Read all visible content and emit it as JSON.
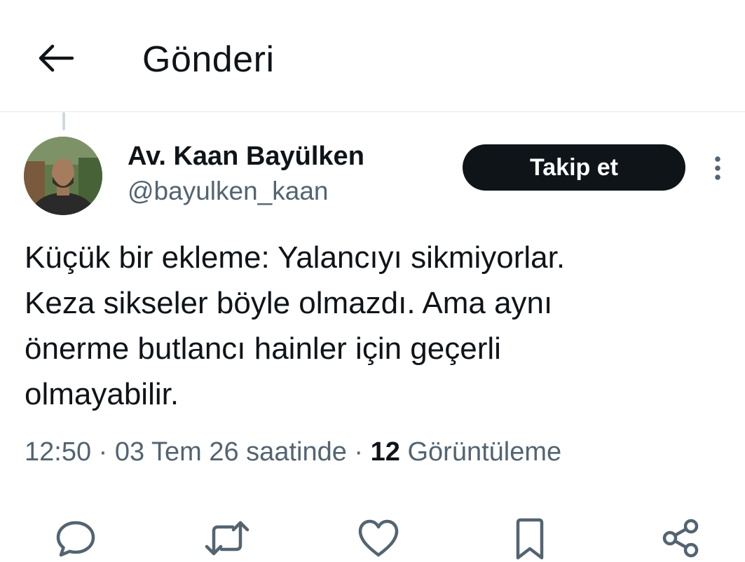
{
  "header": {
    "title": "Gönderi",
    "back_icon": "arrow-left-icon"
  },
  "author": {
    "name": "Av. Kaan Bayülken",
    "handle": "@bayulken_kaan"
  },
  "follow_label": "Takip et",
  "tweet": {
    "text": "Küçük bir ekleme: Yalancıyı sikmiyorlar.\nKeza sikseler böyle olmazdı. Ama aynı\nönerme butlancı hainler için geçerli\nolmayabilir."
  },
  "meta": {
    "time": "12:50",
    "sep1": " · ",
    "date": "03 Tem 26 saatinde",
    "sep2": " · ",
    "views_count": "12",
    "views_label": "Görüntüleme"
  },
  "actions": [
    "reply-icon",
    "retweet-icon",
    "like-icon",
    "bookmark-icon",
    "share-icon"
  ],
  "colors": {
    "text": "#0f1419",
    "secondary": "#536471",
    "divider": "#e6e9eb",
    "button": "#0f1419"
  }
}
